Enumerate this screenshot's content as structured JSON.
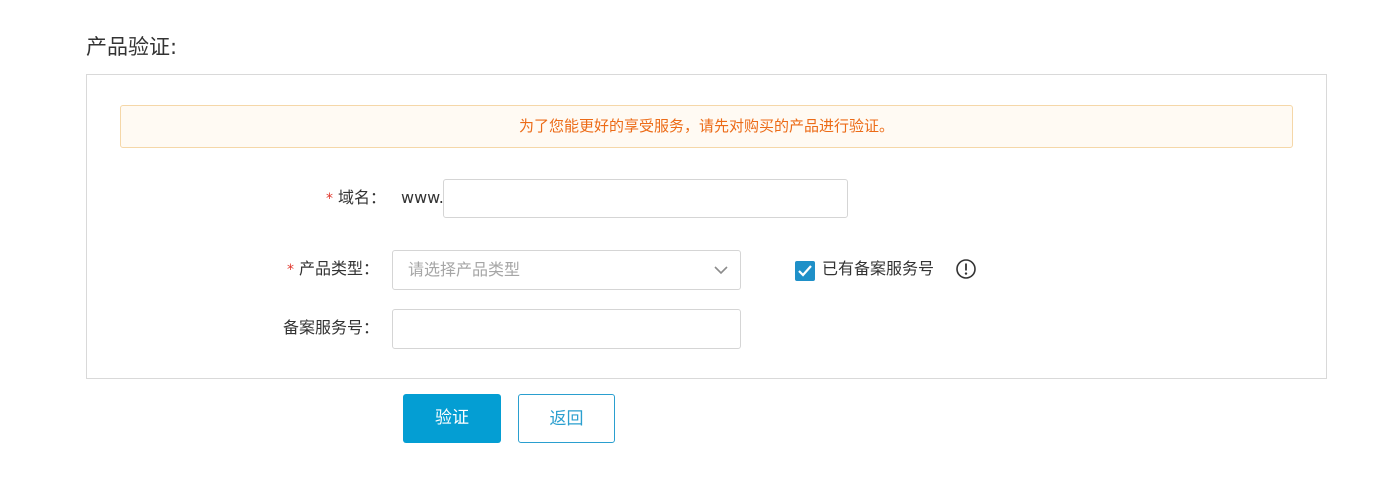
{
  "page": {
    "title": "产品验证:"
  },
  "notice": {
    "text": "为了您能更好的享受服务，请先对购买的产品进行验证。"
  },
  "form": {
    "domain": {
      "required_mark": "*",
      "label": "域名：",
      "prefix": "www.",
      "value": ""
    },
    "product_type": {
      "required_mark": "*",
      "label": "产品类型：",
      "placeholder": "请选择产品类型",
      "icon": "chevron-down-icon"
    },
    "has_record": {
      "checked": true,
      "label": "已有备案服务号",
      "info_icon": "info-circle-icon"
    },
    "record_number": {
      "label": "备案服务号：",
      "value": ""
    }
  },
  "actions": {
    "verify_label": "验证",
    "back_label": "返回"
  },
  "colors": {
    "notice_text": "#ec6b17",
    "notice_bg": "#fffaf3",
    "notice_border": "#f5d7a8",
    "primary": "#049ed3",
    "checkbox": "#1f90c8",
    "required": "#e0352b"
  }
}
